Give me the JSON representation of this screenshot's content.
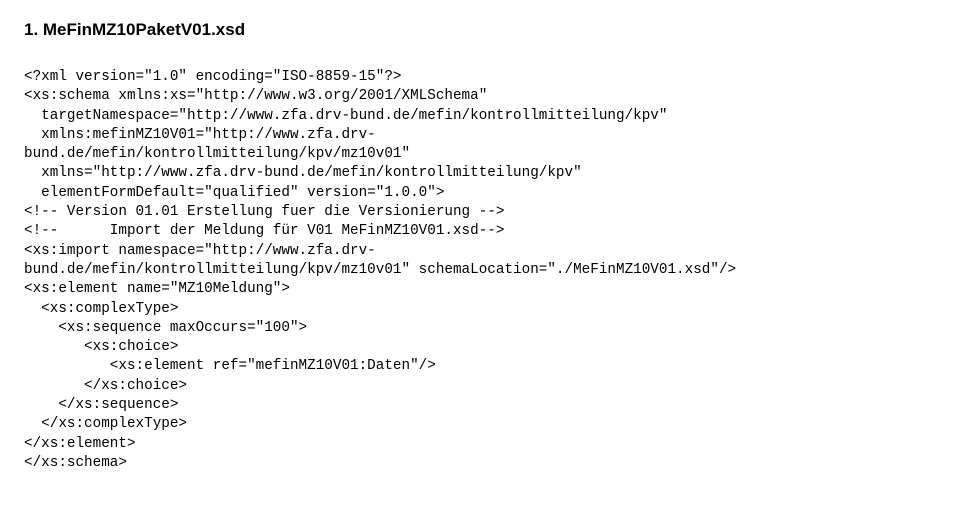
{
  "heading": "1.  MeFinMZ10PaketV01.xsd",
  "code": "<?xml version=\"1.0\" encoding=\"ISO-8859-15\"?>\n<xs:schema xmlns:xs=\"http://www.w3.org/2001/XMLSchema\"\n  targetNamespace=\"http://www.zfa.drv-bund.de/mefin/kontrollmitteilung/kpv\"\n  xmlns:mefinMZ10V01=\"http://www.zfa.drv-\nbund.de/mefin/kontrollmitteilung/kpv/mz10v01\"\n  xmlns=\"http://www.zfa.drv-bund.de/mefin/kontrollmitteilung/kpv\"\n  elementFormDefault=\"qualified\" version=\"1.0.0\">\n<!-- Version 01.01 Erstellung fuer die Versionierung -->\n<!--      Import der Meldung für V01 MeFinMZ10V01.xsd-->\n<xs:import namespace=\"http://www.zfa.drv-\nbund.de/mefin/kontrollmitteilung/kpv/mz10v01\" schemaLocation=\"./MeFinMZ10V01.xsd\"/>\n<xs:element name=\"MZ10Meldung\">\n  <xs:complexType>\n    <xs:sequence maxOccurs=\"100\">\n       <xs:choice>\n          <xs:element ref=\"mefinMZ10V01:Daten\"/>\n       </xs:choice>\n    </xs:sequence>\n  </xs:complexType>\n</xs:element>\n</xs:schema>"
}
